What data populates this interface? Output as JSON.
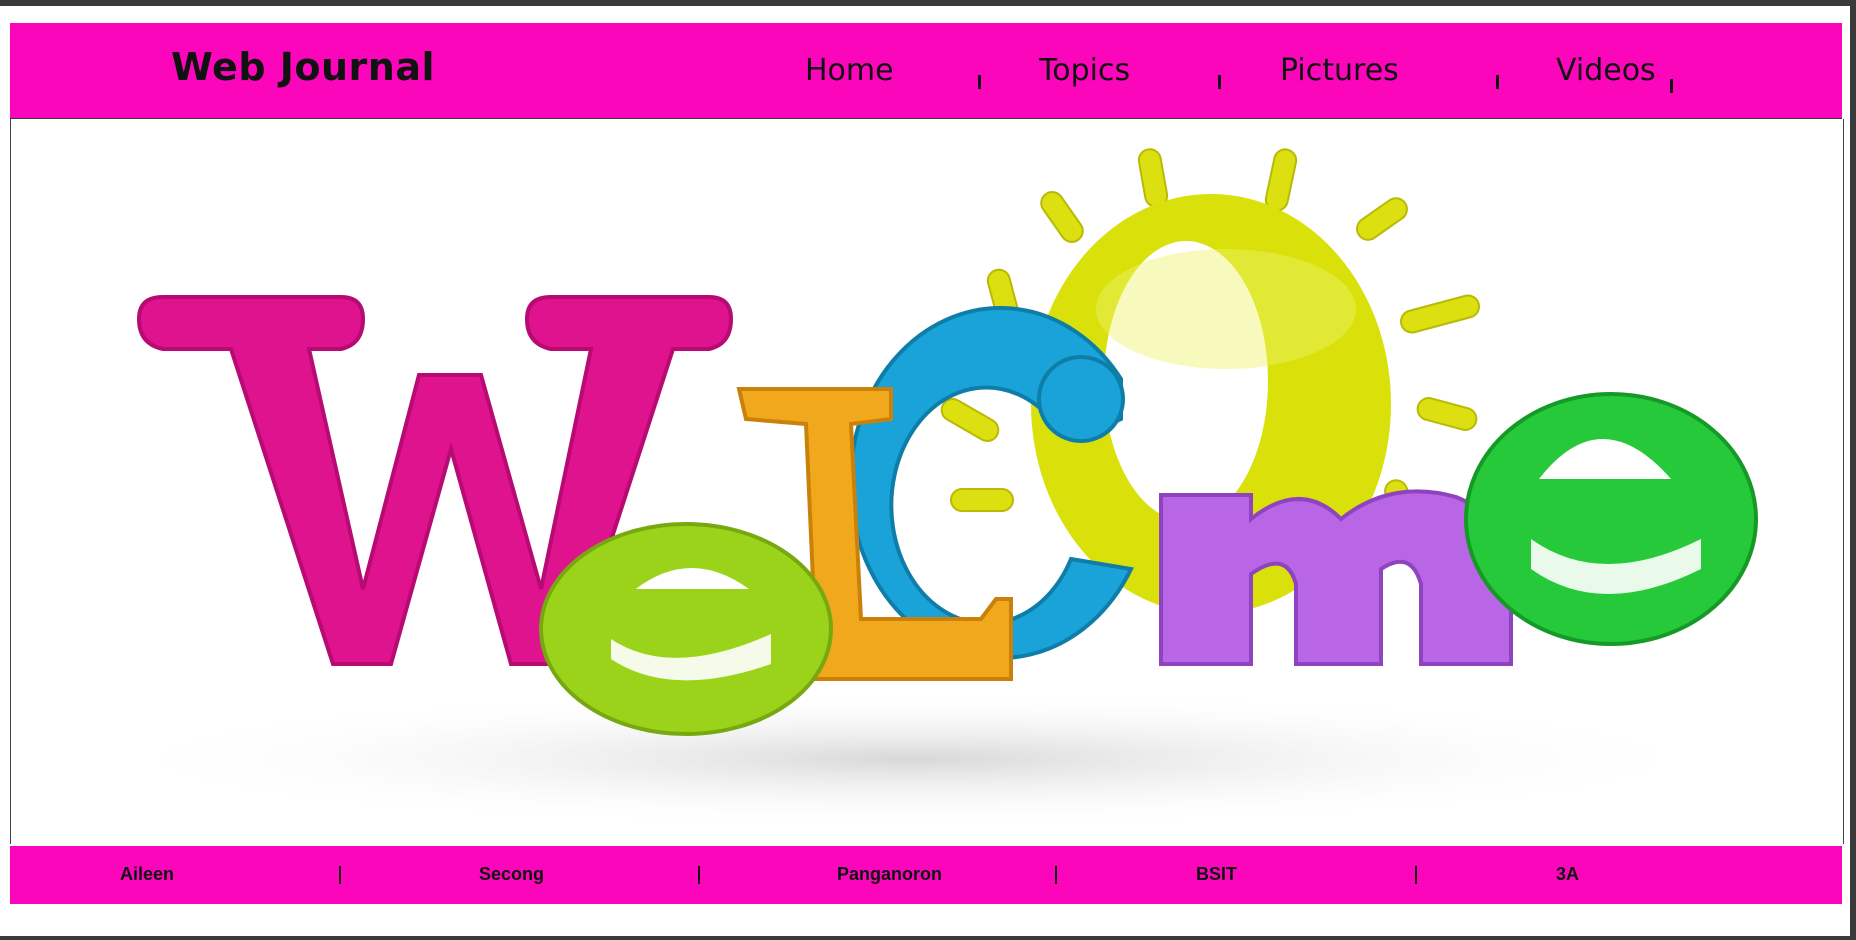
{
  "header": {
    "brand": "Web Journal",
    "nav": [
      {
        "label": "Home"
      },
      {
        "label": "Topics"
      },
      {
        "label": "Pictures"
      },
      {
        "label": "Videos"
      }
    ]
  },
  "hero": {
    "image_alt": "Welcome",
    "letters": [
      "W",
      "e",
      "L",
      "C",
      "O",
      "m",
      "e"
    ],
    "colors": {
      "W": "#e0138f",
      "e1": "#9bd31b",
      "L": "#f2a81d",
      "C": "#1aa3d9",
      "O": "#d9e00a",
      "m": "#b865e6",
      "e2": "#26c93a"
    }
  },
  "footer": {
    "items": [
      {
        "label": "Aileen"
      },
      {
        "label": "Secong"
      },
      {
        "label": "Panganoron"
      },
      {
        "label": "BSIT"
      },
      {
        "label": "3A"
      }
    ],
    "separator": "|"
  },
  "colors": {
    "accent": "#fc06bb",
    "frame": "#3a3a3a",
    "text": "#111111"
  }
}
